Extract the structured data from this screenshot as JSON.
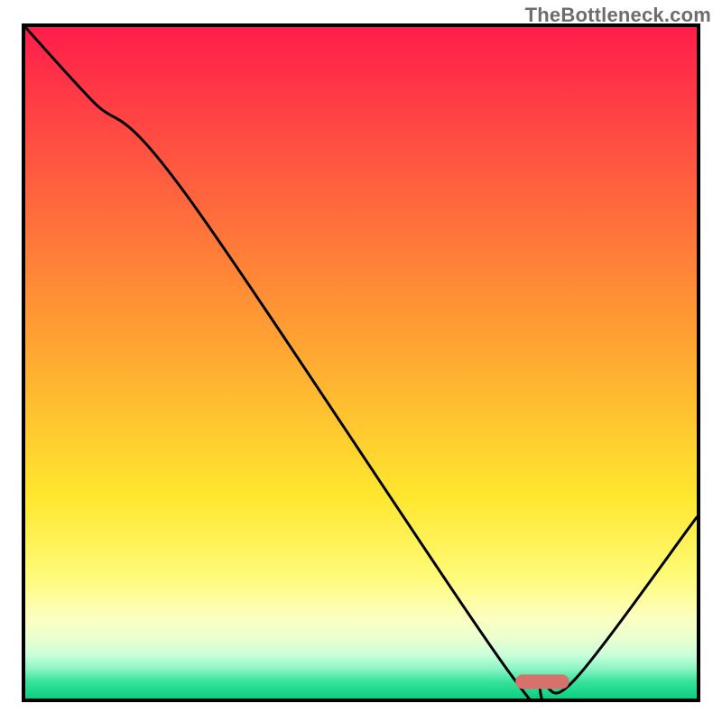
{
  "watermark": "TheBottleneck.com",
  "chart_data": {
    "type": "line",
    "title": "",
    "xlabel": "",
    "ylabel": "",
    "xlim": [
      0,
      100
    ],
    "ylim": [
      0,
      100
    ],
    "grid": false,
    "legend": false,
    "annotations": [],
    "axis_ticks": {
      "x": [],
      "y": []
    },
    "series": [
      {
        "name": "bottleneck-curve",
        "x": [
          0,
          10,
          24,
          72,
          77,
          82,
          100
        ],
        "y": [
          100,
          89,
          75,
          4,
          2,
          3,
          27
        ],
        "note": "smooth v-shaped curve descending from top-left, bottoming near x≈77, rising toward x=100"
      }
    ],
    "marker": {
      "shape": "rounded-bar",
      "x_range": [
        73,
        81
      ],
      "y": 2.5,
      "color": "#d6716b"
    },
    "background_gradient": {
      "type": "vertical",
      "stops": [
        {
          "pos": 0.0,
          "color": "#ff1d4b"
        },
        {
          "pos": 0.47,
          "color": "#ffa332"
        },
        {
          "pos": 0.7,
          "color": "#ffe72e"
        },
        {
          "pos": 0.82,
          "color": "#fffb7a"
        },
        {
          "pos": 0.88,
          "color": "#fcffc0"
        },
        {
          "pos": 0.91,
          "color": "#eaffd0"
        },
        {
          "pos": 0.935,
          "color": "#c9ffda"
        },
        {
          "pos": 0.955,
          "color": "#8ef5c6"
        },
        {
          "pos": 0.975,
          "color": "#36e29a"
        },
        {
          "pos": 1.0,
          "color": "#0ccf7f"
        }
      ]
    }
  }
}
